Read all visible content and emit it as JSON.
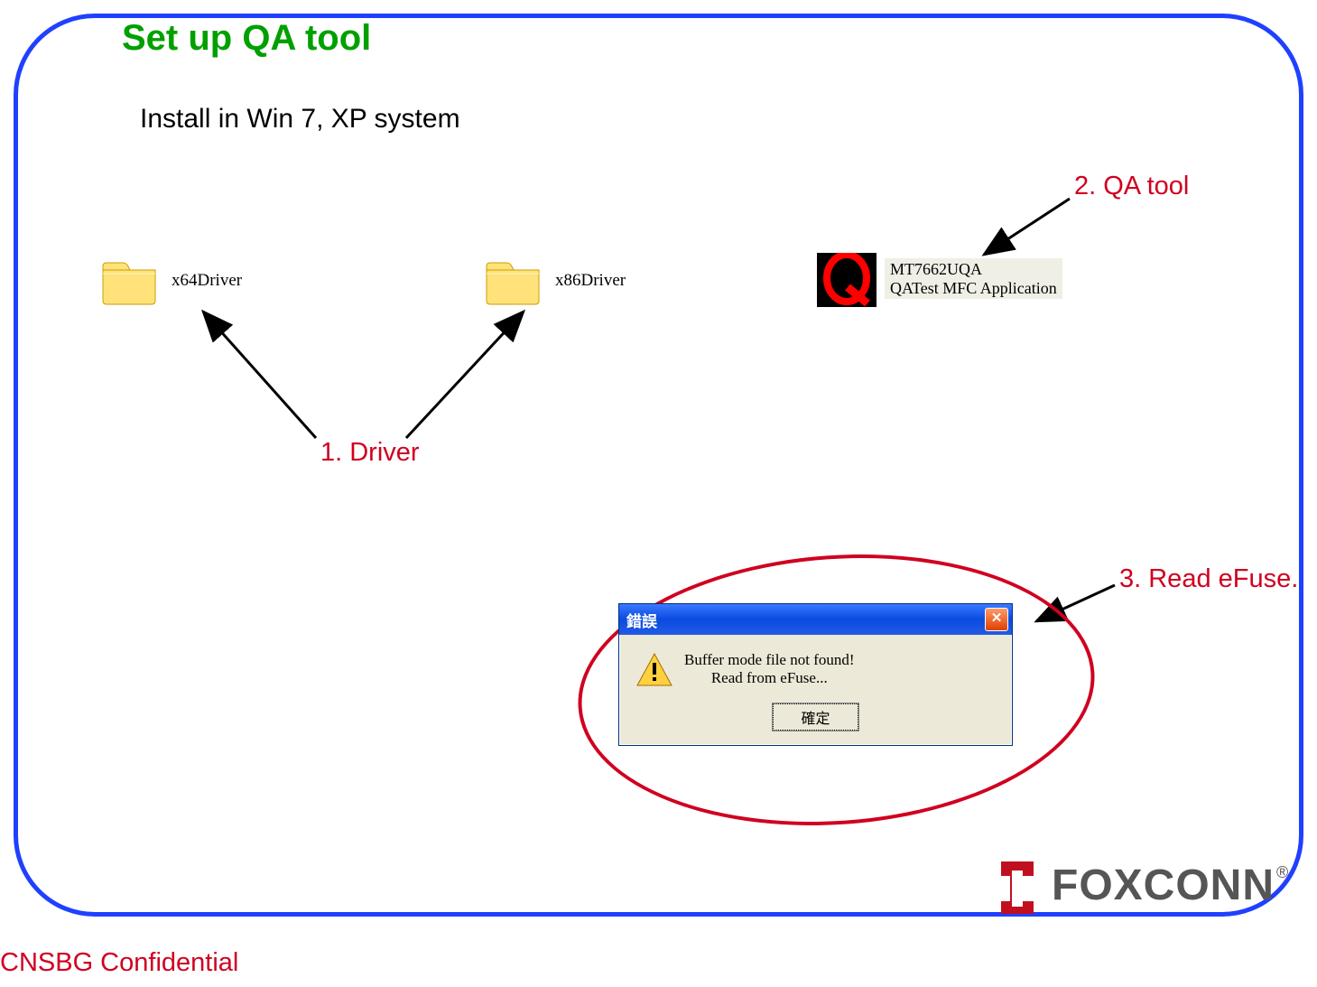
{
  "slide": {
    "title": "Set up QA tool",
    "subtitle": "Install in Win 7, XP system"
  },
  "folders": {
    "x64": "x64Driver",
    "x86": "x86Driver"
  },
  "qa_app": {
    "line1": "MT7662UQA",
    "line2": "QATest MFC Application",
    "icon_letter": "Q"
  },
  "annotations": {
    "driver": "1.  Driver",
    "qa_tool": "2. QA tool",
    "efuse": "3. Read eFuse."
  },
  "dialog": {
    "title": "錯誤",
    "msg_line1": "Buffer mode file not found!",
    "msg_line2": "Read from eFuse...",
    "ok_button": "確定"
  },
  "logo": {
    "text": "FOXCONN",
    "reg": "®"
  },
  "footer": "CNSBG Confidential",
  "colors": {
    "frame": "#2040ff",
    "title": "#00a000",
    "annotation": "#d00020"
  }
}
